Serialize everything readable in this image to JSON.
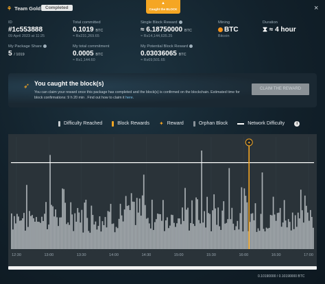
{
  "header": {
    "team_name": "Team Gold",
    "status_badge": "Completed",
    "tag_label": "Caught the BLOCK",
    "close_symbol": "×"
  },
  "stats": {
    "id": {
      "label": "ID",
      "value": "#1c553888",
      "sub": "09 April 2023 at 11:25"
    },
    "total_committed": {
      "label": "Total committed",
      "value": "0.1019",
      "unit": "BTC",
      "sub": "≈ Rs231,269.65"
    },
    "single_block_reward": {
      "label": "Single Block Reward",
      "value": "≈ 6.18750000",
      "unit": "BTC",
      "sub": "≈ Rs14,144,635.25"
    },
    "mining": {
      "label": "Mining",
      "value": "BTC",
      "sub": "Bitcoin"
    },
    "duration": {
      "label": "Duration",
      "value": "⧗ ≈ 4 hour"
    },
    "package_share": {
      "label": "My Package Share",
      "value": "5",
      "total": "/ 1019"
    },
    "my_total_commitment": {
      "label": "My total commitment",
      "value": "0.0005",
      "unit": "BTC",
      "sub": "≈ Rs1,144.60"
    },
    "potential_reward": {
      "label": "My Potential Block Reward",
      "value": "0.03036065",
      "unit": "BTC",
      "sub": "≈ Rs69,501.65"
    }
  },
  "banner": {
    "title": "You caught the block(s)",
    "text": "You can claim your reward once this package has completed and the block(s) is confirmed on the blockchain. Estimated time for block confirmations: 9 h 20 min . Find out how to claim it",
    "link": "here",
    "claim_button": "CLAIM THE REWARD"
  },
  "legend": {
    "difficulty_reached": "Difficulty Reached",
    "block_rewards": "Block Rewards",
    "reward": "Reward",
    "orphan_block": "Orphan Block",
    "network_difficulty": "Network Difficulty"
  },
  "colors": {
    "accent": "#f5a623",
    "bar": "#a9afb3",
    "reward_line": "#f5a623",
    "network_line": "#ffffff",
    "plot_bg": "#2a3339"
  },
  "chart_data": {
    "type": "bar",
    "x_ticks": [
      "12:30",
      "13:00",
      "13:30",
      "14:00",
      "14:30",
      "15:00",
      "15:30",
      "16:00",
      "16:30",
      "17:00"
    ],
    "network_difficulty_level": 0.79,
    "reward_marker_time": "16:05",
    "bar_count": 220,
    "bar_height_range": [
      0.08,
      0.62
    ],
    "spike_levels": [
      0.86,
      0.9,
      0.74,
      0.7,
      0.68
    ]
  },
  "footer": {
    "value": "0.10190000 / 0.10190000 BTC"
  }
}
